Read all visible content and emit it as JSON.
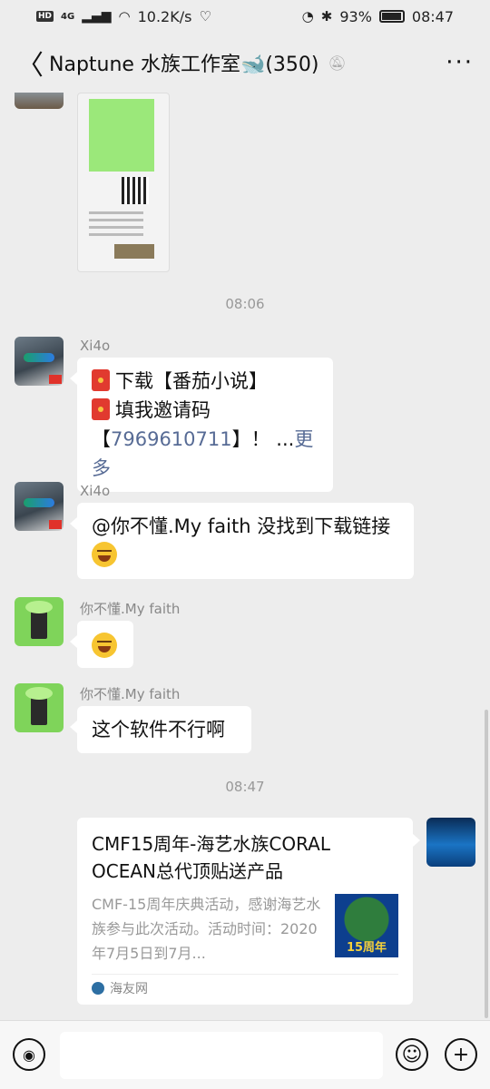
{
  "status_bar": {
    "hd_badge": "HD",
    "network": "4G",
    "speed": "10.2K/s",
    "battery": "93%",
    "time": "08:47"
  },
  "header": {
    "back": "〈",
    "title": "Naptune 水族工作室🐋(350)",
    "more": "···"
  },
  "messages": {
    "time1": "08:06",
    "m1": {
      "nick": "Xi4o",
      "line1": "下载【番茄小说】",
      "line2": "填我邀请码",
      "line3_pre": "【",
      "line3_code": "7969610711",
      "line3_post": "】！ ...",
      "more": "更多"
    },
    "m2": {
      "nick": "Xi4o",
      "text": "@你不懂.My faith  没找到下载链接"
    },
    "m3": {
      "nick": "你不懂.My faith"
    },
    "m4": {
      "nick": "你不懂.My faith",
      "text": "这个软件不行啊"
    },
    "time2": "08:47",
    "card": {
      "title": "CMF15周年-海艺水族CORAL OCEAN总代顶贴送产品",
      "desc": "CMF-15周年庆典活动，感谢海艺水族参与此次活动。活动时间：2020年7月5日到7月...",
      "thumb_text": "15周年",
      "source": "海友网"
    }
  },
  "input": {
    "voice": "◉",
    "emoji": "☺",
    "plus": "+"
  }
}
